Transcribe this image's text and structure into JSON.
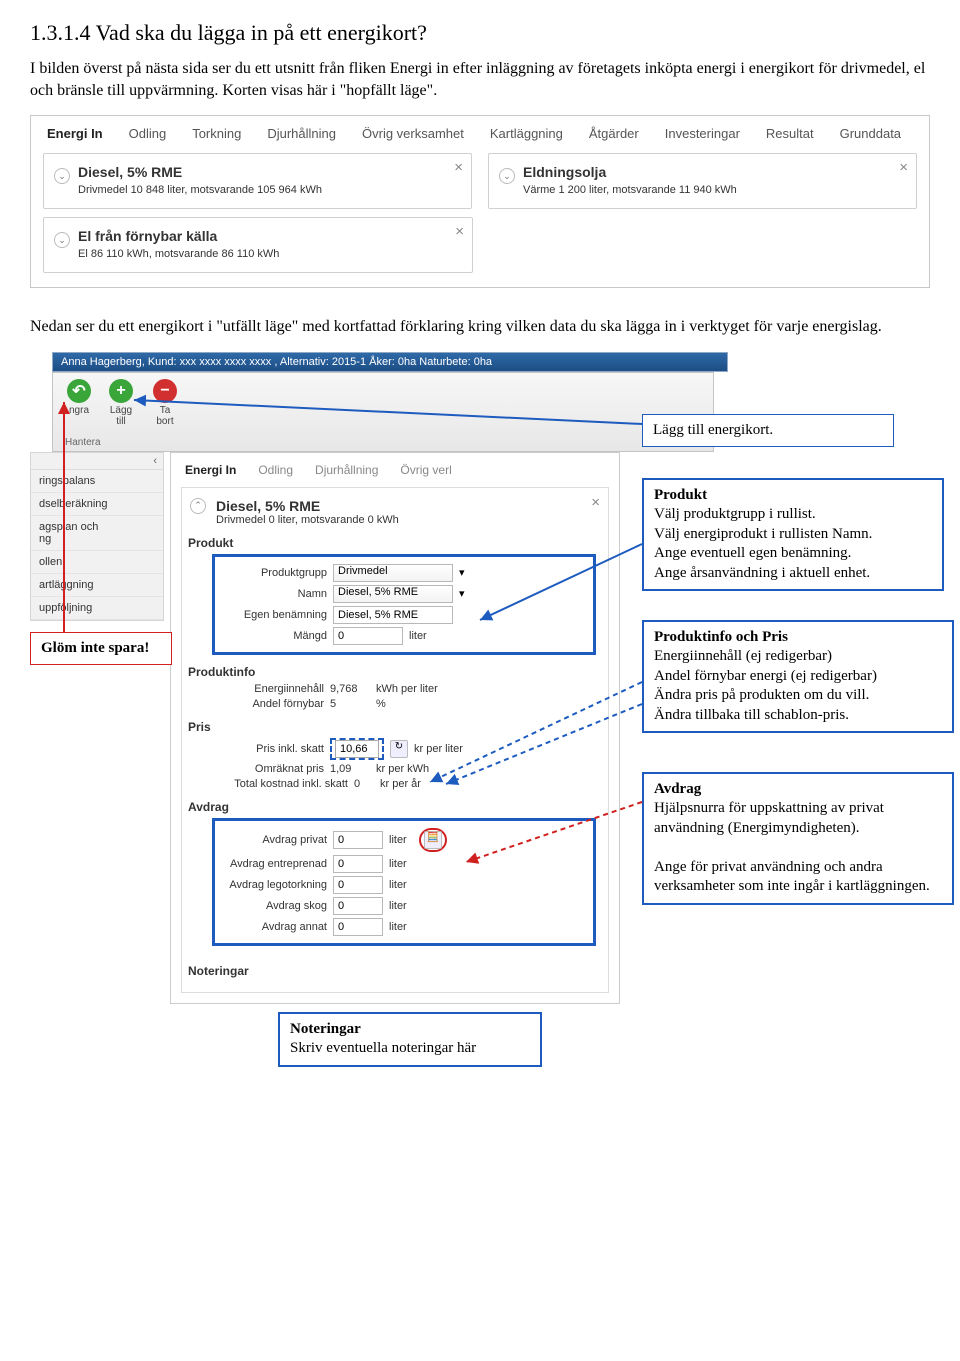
{
  "doc": {
    "heading": "1.3.1.4 Vad ska du lägga in på ett energikort?",
    "p1": "I bilden överst på nästa sida ser du ett utsnitt från fliken Energi in efter inläggning av företagets inköpta energi i energikort för drivmedel, el och bränsle till uppvärmning. Korten visas här i \"hopfällt läge\".",
    "p2": "Nedan ser du ett energikort i \"utfällt läge\" med kortfattad förklaring kring vilken data du ska lägga in i verktyget för varje energislag."
  },
  "app1": {
    "tabs": [
      "Energi In",
      "Odling",
      "Torkning",
      "Djurhållning",
      "Övrig verksamhet",
      "Kartläggning",
      "Åtgärder",
      "Investeringar",
      "Resultat",
      "Grunddata"
    ],
    "cards": [
      {
        "title": "Diesel, 5% RME",
        "sub": "Drivmedel 10 848 liter, motsvarande 105 964 kWh"
      },
      {
        "title": "Eldningsolja",
        "sub": "Värme 1 200 liter, motsvarande 11 940 kWh"
      },
      {
        "title": "El från förnybar källa",
        "sub": "El 86 110 kWh, motsvarande 86 110 kWh"
      }
    ]
  },
  "app2": {
    "windowTitle": "Anna Hagerberg, Kund: xxx xxxx xxxx xxxx , Alternativ: 2015-1 Åker: 0ha Naturbete: 0ha",
    "ribbon": {
      "undo": "ngra",
      "add": "Lägg\ntill",
      "remove": "Ta\nbort",
      "section": "Hantera"
    },
    "sidebar": [
      "ringsbalans",
      "dselberäkning",
      "agsplan och\nng",
      "ollen",
      "artläggning",
      "uppföljning"
    ],
    "tabs2": [
      "Energi In",
      "Odling",
      "Djurhållning",
      "Övrig verl"
    ],
    "card": {
      "title": "Diesel, 5% RME",
      "sub": "Drivmedel 0 liter, motsvarande 0 kWh",
      "section_produkt": "Produkt",
      "labels": {
        "produktgrupp": "Produktgrupp",
        "namn": "Namn",
        "egen": "Egen benämning",
        "mangd": "Mängd"
      },
      "values": {
        "produktgrupp": "Drivmedel",
        "namn": "Diesel, 5% RME",
        "egen": "Diesel, 5% RME",
        "mangd": "0",
        "mangd_unit": "liter"
      },
      "section_produktinfo": "Produktinfo",
      "info": {
        "energiinnehall_label": "Energiinnehåll",
        "energiinnehall_val": "9,768",
        "energiinnehall_unit": "kWh per liter",
        "andel_label": "Andel förnybar",
        "andel_val": "5",
        "andel_unit": "%"
      },
      "section_pris": "Pris",
      "pris": {
        "pris_label": "Pris inkl. skatt",
        "pris_val": "10,66",
        "pris_unit": "kr per liter",
        "omr_label": "Omräknat pris",
        "omr_val": "1,09",
        "omr_unit": "kr per kWh",
        "tot_label": "Total kostnad inkl. skatt",
        "tot_val": "0",
        "tot_unit": "kr per år"
      },
      "section_avdrag": "Avdrag",
      "avdrag_labels": [
        "Avdrag privat",
        "Avdrag entreprenad",
        "Avdrag legotorkning",
        "Avdrag skog",
        "Avdrag annat"
      ],
      "avdrag_val": "0",
      "avdrag_unit": "liter",
      "section_noteringar": "Noteringar"
    }
  },
  "annotations": {
    "glom": "Glöm inte spara!",
    "laggtill": "Lägg till energikort.",
    "produkt_h": "Produkt",
    "produkt_b": "Välj produktgrupp i rullist.\nVälj energiprodukt i rullisten Namn.\nAnge eventuell egen benämning.\nAnge årsanvändning i aktuell enhet.",
    "prodinfo_h": "Produktinfo och Pris",
    "prodinfo_b": "Energiinnehåll (ej redigerbar)\nAndel förnybar energi (ej redigerbar)\nÄndra pris på produkten om du vill.\nÄndra tillbaka till schablon-pris.",
    "avdrag_h": "Avdrag",
    "avdrag_b": "Hjälpsnurra för uppskattning av privat användning (Energimyndigheten).\n\nAnge för privat användning och andra verksamheter som inte ingår i kartläggningen.",
    "noteringar_h": "Noteringar",
    "noteringar_b": "Skriv eventuella noteringar här"
  }
}
